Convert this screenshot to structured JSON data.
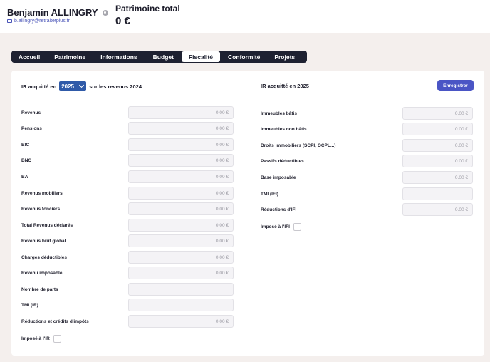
{
  "header": {
    "client_name": "Benjamin ALLINGRY",
    "client_email": "b.allingry@retraitetplus.fr",
    "patrimoine_label": "Patrimoine total",
    "patrimoine_value": "0 €"
  },
  "tabs": [
    {
      "label": "Accueil",
      "active": false
    },
    {
      "label": "Patrimoine",
      "active": false
    },
    {
      "label": "Informations",
      "active": false
    },
    {
      "label": "Budget",
      "active": false
    },
    {
      "label": "Fiscalité",
      "active": true
    },
    {
      "label": "Conformité",
      "active": false
    },
    {
      "label": "Projets",
      "active": false
    }
  ],
  "ir": {
    "title_prefix": "IR acquitté en",
    "year_selected": "2025",
    "title_suffix": "sur les revenus 2024",
    "fields": [
      {
        "label": "Revenus",
        "placeholder": "0.00 €"
      },
      {
        "label": "Pensions",
        "placeholder": "0.00 €"
      },
      {
        "label": "BIC",
        "placeholder": "0.00 €"
      },
      {
        "label": "BNC",
        "placeholder": "0.00 €"
      },
      {
        "label": "BA",
        "placeholder": "0.00 €"
      },
      {
        "label": "Revenus mobiliers",
        "placeholder": "0.00 €"
      },
      {
        "label": "Revenus fonciers",
        "placeholder": "0.00 €"
      },
      {
        "label": "Total Revenus déclarés",
        "placeholder": "0.00 €"
      },
      {
        "label": "Revenus brut global",
        "placeholder": "0.00 €"
      },
      {
        "label": "Charges déductibles",
        "placeholder": "0.00 €"
      },
      {
        "label": "Revenu imposable",
        "placeholder": "0.00 €"
      },
      {
        "label": "Nombre de parts",
        "placeholder": ""
      },
      {
        "label": "TMI (IR)",
        "placeholder": ""
      },
      {
        "label": "Réductions et crédits d'impôts",
        "placeholder": "0.00 €"
      }
    ],
    "checkbox_label": "Imposé à l'IR"
  },
  "ifi": {
    "title": "IR acquitté en 2025",
    "save_label": "Enregistrer",
    "fields": [
      {
        "label": "Immeubles bâtis",
        "placeholder": "0.00 €"
      },
      {
        "label": "Immeubles non bâtis",
        "placeholder": "0.00 €"
      },
      {
        "label": "Droits immobiliers (SCPI, OCPL...)",
        "placeholder": "0.00 €"
      },
      {
        "label": "Passifs déductibles",
        "placeholder": "0.00 €"
      },
      {
        "label": "Base imposable",
        "placeholder": "0.00 €"
      },
      {
        "label": "TMI (IFI)",
        "placeholder": ""
      },
      {
        "label": "Réductions d'IFI",
        "placeholder": "0.00 €"
      }
    ],
    "checkbox_label": "Imposé à l'IFI"
  }
}
